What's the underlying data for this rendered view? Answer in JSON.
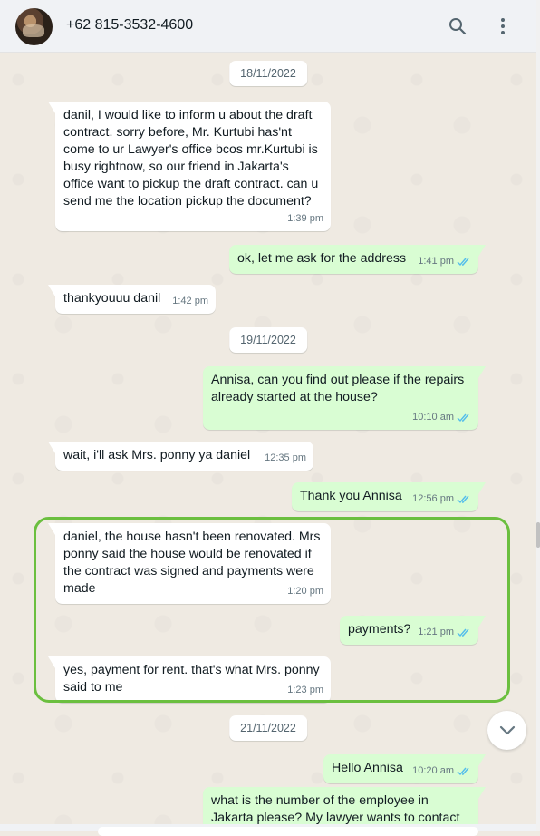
{
  "header": {
    "contact": "+62 815-3532-4600",
    "avatar_icon": "profile-photo",
    "search_icon": "search-icon",
    "menu_icon": "kebab-menu-icon"
  },
  "dates": [
    "18/11/2022",
    "19/11/2022",
    "21/11/2022"
  ],
  "messages": [
    {
      "dir": "in",
      "text": "danil, I would like to inform u about the draft contract. sorry before, Mr. Kurtubi has'nt come to ur Lawyer's office bcos mr.Kurtubi is busy rightnow, so our friend in Jakarta's office want to pickup the draft contract. can u send me the location pickup the document?",
      "time": "1:39 pm"
    },
    {
      "dir": "out",
      "text": "ok, let me ask for the address",
      "time": "1:41 pm"
    },
    {
      "dir": "in",
      "text": "thankyouuu danil",
      "time": "1:42 pm"
    },
    {
      "dir": "out",
      "text": "Annisa, can you find out please if the repairs already started at the house?",
      "time": "10:10 am"
    },
    {
      "dir": "in",
      "text": "wait, i'll ask Mrs. ponny ya daniel",
      "time": "12:35 pm"
    },
    {
      "dir": "out",
      "text": "Thank you Annisa",
      "time": "12:56 pm"
    },
    {
      "dir": "in",
      "text": "daniel, the house hasn't been renovated. Mrs ponny said the house would be renovated if the contract was signed and payments were made",
      "time": "1:20 pm"
    },
    {
      "dir": "out",
      "text": "payments?",
      "time": "1:21 pm"
    },
    {
      "dir": "in",
      "text": "yes, payment for rent.  that's what Mrs. ponny said to me",
      "time": "1:23 pm"
    },
    {
      "dir": "out",
      "text": "Hello Annisa",
      "time": "10:20 am"
    },
    {
      "dir": "out",
      "text": "what is the number of the employee in Jakarta please? My lawyer wants to contact",
      "time": ""
    }
  ],
  "colors": {
    "incoming": "#ffffff",
    "outgoing": "#d9fdd3",
    "read_ticks": "#53bdeb",
    "highlight": "#6bbf3f"
  },
  "scroll_down_icon": "chevron-down-icon"
}
